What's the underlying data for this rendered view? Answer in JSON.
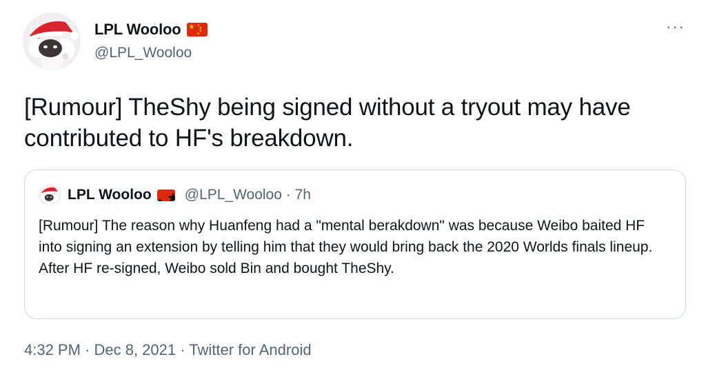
{
  "tweet": {
    "author_name": "LPL Wooloo",
    "author_handle": "@LPL_Wooloo",
    "more_label": "···",
    "text": "[Rumour] TheShy being signed without a tryout may have contributed to HF's breakdown.",
    "timestamp": "4:32 PM · Dec 8, 2021 · Twitter for Android"
  },
  "quoted": {
    "author_name": "LPL Wooloo",
    "author_handle": "@LPL_Wooloo · 7h",
    "text": "[Rumour] The reason why Huanfeng had a \"mental berakdown\" was because Weibo baited HF into signing an extension by telling him that they would bring back the 2020 Worlds finals lineup. After HF re-signed, Weibo sold Bin and bought TheShy."
  },
  "icons": {
    "flag": "china-flag-icon",
    "avatar": "wooloo-santa-hat-avatar",
    "more": "more-options-icon"
  },
  "colors": {
    "text": "#0f1419",
    "secondary": "#536471",
    "border": "#cfd9de",
    "flag_red": "#de2910",
    "flag_yellow": "#ffde00"
  }
}
